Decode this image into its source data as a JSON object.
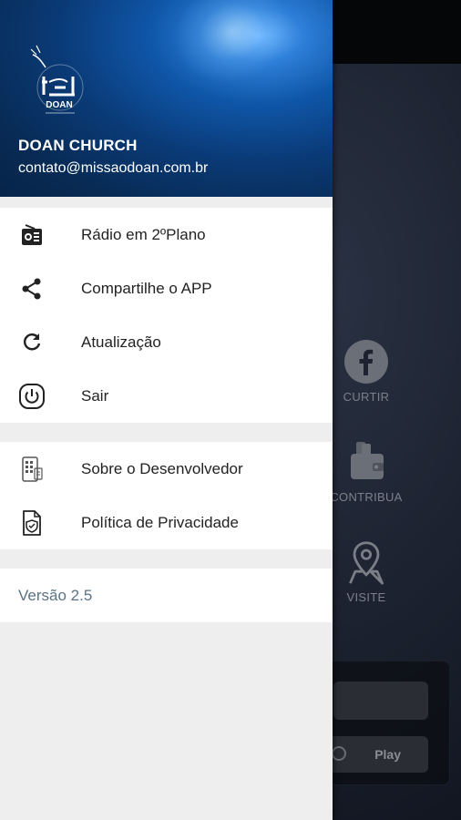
{
  "header": {
    "logo_text": "DOAN",
    "title": "DOAN CHURCH",
    "email": "contato@missaodoan.com.br"
  },
  "menu_primary": [
    {
      "label": "Rádio em 2ºPlano",
      "icon": "radio-icon"
    },
    {
      "label": "Compartilhe o APP",
      "icon": "share-icon"
    },
    {
      "label": "Atualização",
      "icon": "refresh-icon"
    },
    {
      "label": "Sair",
      "icon": "power-icon"
    }
  ],
  "menu_secondary": [
    {
      "label": "Sobre o Desenvolvedor",
      "icon": "developer-icon"
    },
    {
      "label": "Política de Privacidade",
      "icon": "privacy-document-icon"
    }
  ],
  "version": "Versão 2.5",
  "background_app": {
    "actions": [
      {
        "label": "CURTIR",
        "icon": "facebook-icon"
      },
      {
        "label": "CONTRIBUA",
        "icon": "wallet-icon"
      },
      {
        "label": "VISITE",
        "icon": "map-pin-icon"
      }
    ],
    "play_label": "Play"
  },
  "colors": {
    "header_blue": "#0f56a8",
    "drawer_bg": "#eeeeee",
    "version_text": "#5a7384"
  }
}
